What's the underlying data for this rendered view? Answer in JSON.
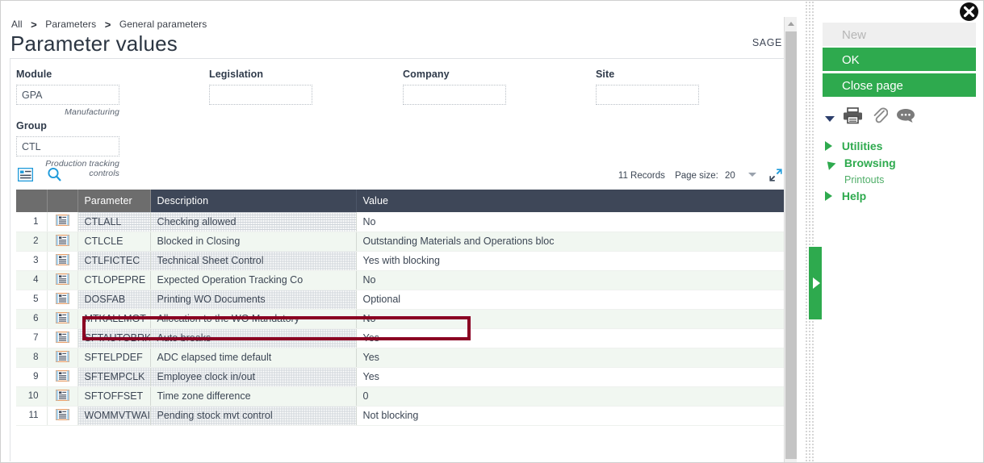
{
  "breadcrumb": {
    "items": [
      "All",
      "Parameters",
      "General parameters"
    ],
    "separator": ">"
  },
  "header": {
    "title": "Parameter values",
    "brand": "SAGE"
  },
  "form": {
    "module": {
      "label": "Module",
      "value": "GPA",
      "hint": "Manufacturing"
    },
    "legislation": {
      "label": "Legislation",
      "value": "",
      "hint": ""
    },
    "company": {
      "label": "Company",
      "value": "",
      "hint": ""
    },
    "site": {
      "label": "Site",
      "value": "",
      "hint": ""
    },
    "group": {
      "label": "Group",
      "value": "CTL",
      "hint": "Production tracking controls"
    }
  },
  "grid_toolbar": {
    "grid_view_icon": "grid-view-icon",
    "search_icon": "search-icon",
    "records_label": "11 Records",
    "page_size_label": "Page size:",
    "page_size_value": "20",
    "expand_icon": "expand-icon"
  },
  "table": {
    "columns": [
      "",
      "",
      "Parameter",
      "Description",
      "Value"
    ],
    "row_icon": "record-detail-icon",
    "rows": [
      {
        "num": "1",
        "parameter": "CTLALL",
        "description": "Checking allowed",
        "value": "No"
      },
      {
        "num": "2",
        "parameter": "CTLCLE",
        "description": "Blocked in Closing",
        "value": "Outstanding Materials and Operations bloc"
      },
      {
        "num": "3",
        "parameter": "CTLFICTEC",
        "description": "Technical Sheet Control",
        "value": "Yes with blocking"
      },
      {
        "num": "4",
        "parameter": "CTLOPEPRE",
        "description": "Expected Operation Tracking Co",
        "value": "No"
      },
      {
        "num": "5",
        "parameter": "DOSFAB",
        "description": "Printing WO Documents",
        "value": "Optional"
      },
      {
        "num": "6",
        "parameter": "MTKALLMGT",
        "description": "Allocation to the WO Mandatory",
        "value": "No"
      },
      {
        "num": "7",
        "parameter": "SFTAUTOBRK",
        "description": "Auto breaks",
        "value": "Yes"
      },
      {
        "num": "8",
        "parameter": "SFTELPDEF",
        "description": "ADC elapsed time default",
        "value": "Yes"
      },
      {
        "num": "9",
        "parameter": "SFTEMPCLK",
        "description": "Employee clock in/out",
        "value": "Yes"
      },
      {
        "num": "10",
        "parameter": "SFTOFFSET",
        "description": "Time zone difference",
        "value": "0"
      },
      {
        "num": "11",
        "parameter": "WOMMVTWAI",
        "description": "Pending stock mvt control",
        "value": "Not blocking"
      }
    ],
    "highlight_row_index": 3,
    "highlight_color": "#8a0022"
  },
  "sidebar": {
    "buttons": [
      {
        "label": "New",
        "state": "disabled"
      },
      {
        "label": "OK",
        "state": "primary"
      },
      {
        "label": "Close page",
        "state": "primary"
      }
    ],
    "icons": [
      "dropdown-caret-icon",
      "print-icon",
      "attachment-icon",
      "comment-icon"
    ],
    "nav": [
      {
        "label": "Utilities",
        "expanded": false,
        "children": []
      },
      {
        "label": "Browsing",
        "expanded": true,
        "children": [
          "Printouts"
        ]
      },
      {
        "label": "Help",
        "expanded": false,
        "children": []
      }
    ]
  },
  "window": {
    "close_icon": "close-icon",
    "collapse_handle_icon": "collapse-panel-icon"
  },
  "colors": {
    "accent_green": "#2eaa4e",
    "header_grey": "#6d6d6d",
    "header_dark": "#3e4758",
    "highlight_red": "#8a0022",
    "row_alt": "#f1f7f1"
  }
}
